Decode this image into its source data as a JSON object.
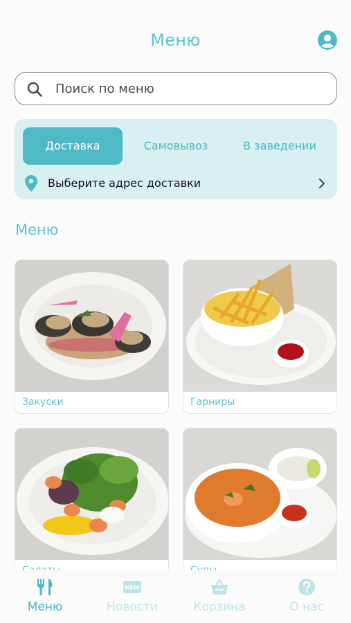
{
  "header": {
    "title": "Меню"
  },
  "search": {
    "placeholder": "Поиск по меню",
    "value": ""
  },
  "order_modes": {
    "tabs": [
      {
        "label": "Доставка",
        "active": true
      },
      {
        "label": "Самовывоз",
        "active": false
      },
      {
        "label": "В заведении",
        "active": false
      }
    ],
    "address_prompt": "Выберите адрес доставки"
  },
  "section": {
    "title": "Меню"
  },
  "categories": [
    {
      "label": "Закуски",
      "image": "stuffed eggplant rolls appetizer"
    },
    {
      "label": "Гарниры",
      "image": "french fries with ketchup"
    },
    {
      "label": "Салаты",
      "image": "shrimp and arugula salad"
    },
    {
      "label": "Супы",
      "image": "tomato soup with shrimp"
    }
  ],
  "bottom_nav": [
    {
      "label": "Меню",
      "icon": "fork-knife-icon",
      "active": true
    },
    {
      "label": "Новости",
      "icon": "new-badge-icon",
      "active": false
    },
    {
      "label": "Корзина",
      "icon": "basket-icon",
      "active": false
    },
    {
      "label": "О нас",
      "icon": "question-icon",
      "active": false
    }
  ],
  "colors": {
    "accent": "#4fb9c5",
    "accent_light": "#d8f0f2",
    "inactive_nav": "#bfe4e8"
  }
}
